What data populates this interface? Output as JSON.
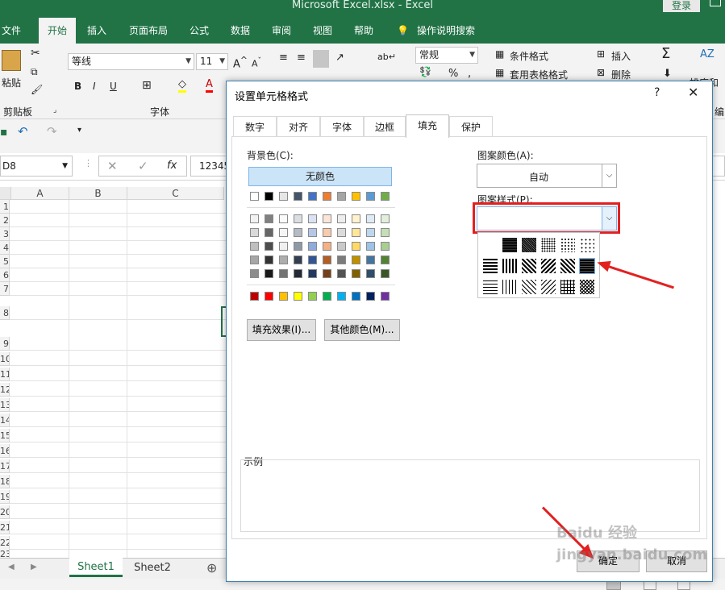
{
  "app": {
    "title": "Microsoft Excel.xlsx  -  Excel",
    "login": "登录"
  },
  "menu": [
    "文件",
    "开始",
    "插入",
    "页面布局",
    "公式",
    "数据",
    "审阅",
    "视图",
    "帮助",
    "操作说明搜索"
  ],
  "ribbon": {
    "paste": "粘贴",
    "clipboard_group": "剪贴板",
    "font_name": "等线",
    "font_size": "11",
    "font_group": "字体",
    "number_format": "常规",
    "conditional_format": "条件格式",
    "table_format": "套用表格格式",
    "insert": "插入",
    "delete": "删除",
    "sort_filter": "排序和",
    "edit_group": "编"
  },
  "formula_bar": {
    "name_box": "D8",
    "value": "12345"
  },
  "columns": [
    "A",
    "B",
    "C"
  ],
  "rows": [
    "1",
    "2",
    "3",
    "4",
    "5",
    "6",
    "7",
    "8",
    "9",
    "10",
    "11",
    "12",
    "13",
    "14",
    "15",
    "16",
    "17",
    "18",
    "19",
    "20",
    "21",
    "22",
    "23"
  ],
  "sheets": [
    "Sheet1",
    "Sheet2"
  ],
  "dialog": {
    "title": "设置单元格格式",
    "help": "?",
    "close": "✕",
    "tabs": [
      "数字",
      "对齐",
      "字体",
      "边框",
      "填充",
      "保护"
    ],
    "bg_color_label": "背景色(C):",
    "no_color": "无颜色",
    "fill_effects": "填充效果(I)...",
    "more_colors": "其他颜色(M)...",
    "pattern_color_label": "图案颜色(A):",
    "pattern_color_value": "自动",
    "pattern_style_label": "图案样式(P):",
    "sample_label": "示例",
    "ok": "确定",
    "cancel": "取消"
  },
  "colors": {
    "accent": "#217346",
    "arrow": "#e32020",
    "theme_row": [
      "#ffffff",
      "#000000",
      "#e7e6e6",
      "#44546a",
      "#4472c4",
      "#ed7d31",
      "#a5a5a5",
      "#ffc000",
      "#5b9bd5",
      "#70ad47"
    ],
    "standard_row": [
      "#c00000",
      "#ff0000",
      "#ffc000",
      "#ffff00",
      "#92d050",
      "#00b050",
      "#00b0f0",
      "#0070c0",
      "#002060",
      "#7030a0"
    ]
  },
  "watermark": "Baidu 经验 jingyan.baidu.com"
}
